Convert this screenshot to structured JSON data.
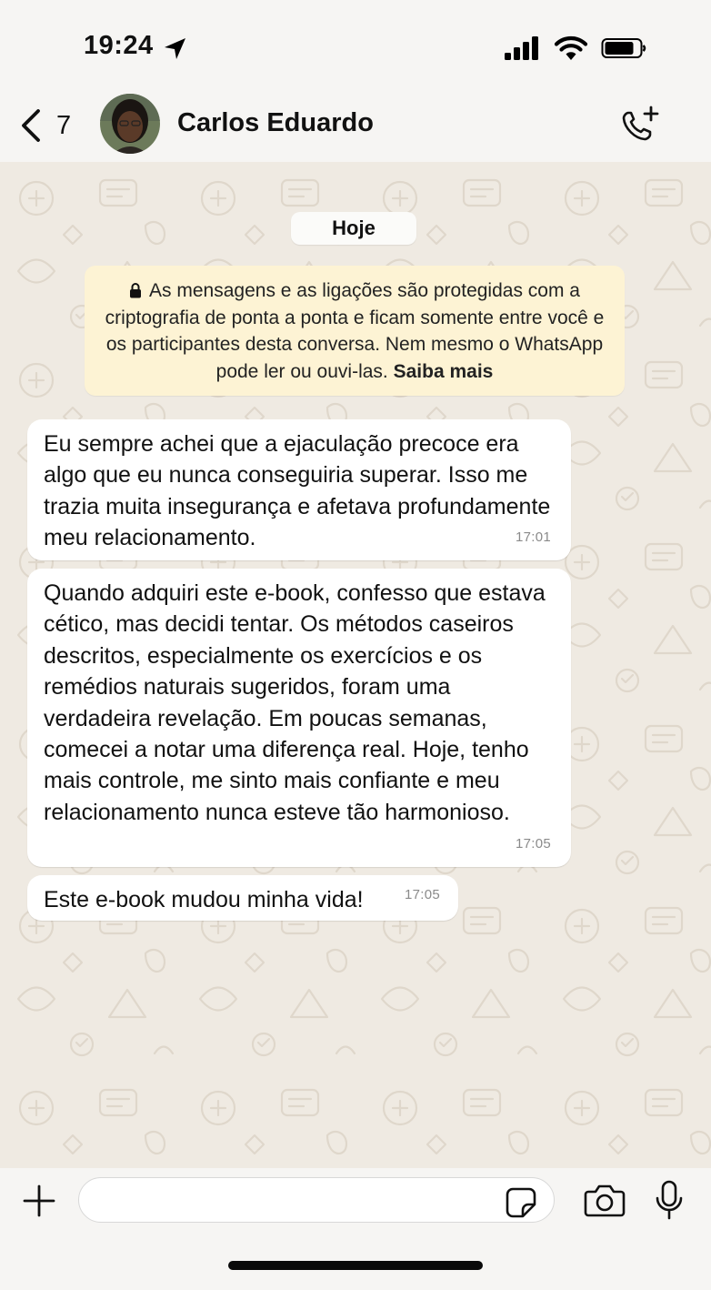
{
  "status_bar": {
    "time": "19:24",
    "icons": [
      "location-arrow-icon",
      "cellular-signal-icon",
      "wifi-icon",
      "battery-icon"
    ]
  },
  "header": {
    "back_count": "7",
    "contact_name": "Carlos Eduardo",
    "icons": [
      "chevron-left-icon",
      "avatar",
      "add-call-icon"
    ]
  },
  "chat": {
    "date_label": "Hoje",
    "encryption_notice": {
      "text": "As mensagens e as ligações são protegidas com a criptografia de ponta a ponta e ficam somente entre você e os participantes desta conversa. Nem mesmo o WhatsApp pode ler ou ouvi-las.",
      "link": "Saiba mais"
    },
    "messages": [
      {
        "text": "Eu sempre achei que a ejaculação precoce era algo que eu nunca conseguiria superar. Isso me trazia muita insegurança e afetava profundamente meu relacionamento.",
        "time": "17:01"
      },
      {
        "text": "Quando adquiri este e-book, confesso que estava cético, mas decidi tentar. Os métodos caseiros descritos, especialmente os exercícios e os remédios naturais sugeridos, foram uma verdadeira revelação. Em poucas semanas, comecei a notar uma diferença real. Hoje, tenho mais controle, me sinto mais confiante e meu relacionamento nunca esteve tão harmonioso.",
        "time": "17:05"
      },
      {
        "text": "Este e-book mudou minha vida!",
        "time": "17:05"
      }
    ]
  },
  "input_bar": {
    "message_value": "",
    "icons": [
      "plus-icon",
      "sticker-icon",
      "camera-icon",
      "microphone-icon"
    ]
  },
  "colors": {
    "chat_background": "#efeae2",
    "bubble_incoming": "#ffffff",
    "encryption_notice_bg": "#fdf3d4",
    "bar_background": "#f6f5f3"
  }
}
